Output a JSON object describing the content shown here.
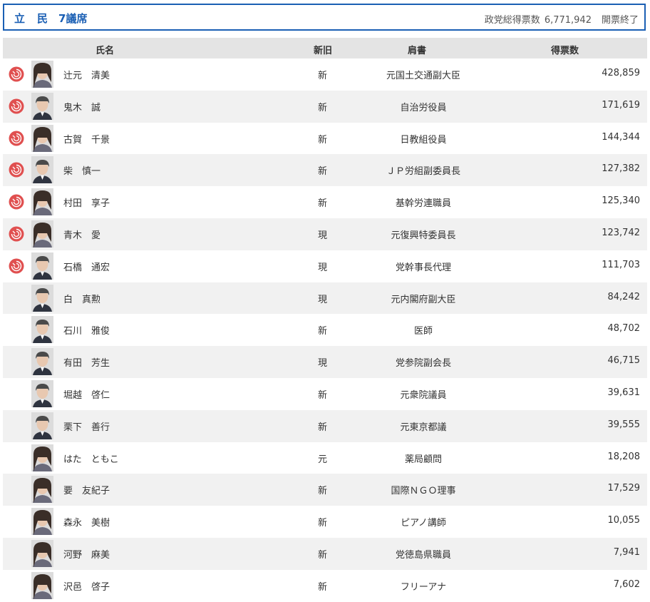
{
  "header": {
    "party": "立　民",
    "seats": "7議席",
    "votes_label": "政党総得票数",
    "total_votes": "6,771,942",
    "status": "開票終了"
  },
  "columns": {
    "name": "氏名",
    "status": "新旧",
    "title": "肩書",
    "votes": "得票数"
  },
  "candidates": [
    {
      "name": "辻元　清美",
      "status": "新",
      "title": "元国土交通副大臣",
      "votes": "428,859",
      "elected": true,
      "gender": "f"
    },
    {
      "name": "鬼木　誠",
      "status": "新",
      "title": "自治労役員",
      "votes": "171,619",
      "elected": true,
      "gender": "m"
    },
    {
      "name": "古賀　千景",
      "status": "新",
      "title": "日教組役員",
      "votes": "144,344",
      "elected": true,
      "gender": "f"
    },
    {
      "name": "柴　慎一",
      "status": "新",
      "title": "ＪＰ労組副委員長",
      "votes": "127,382",
      "elected": true,
      "gender": "m"
    },
    {
      "name": "村田　享子",
      "status": "新",
      "title": "基幹労連職員",
      "votes": "125,340",
      "elected": true,
      "gender": "f"
    },
    {
      "name": "青木　愛",
      "status": "現",
      "title": "元復興特委員長",
      "votes": "123,742",
      "elected": true,
      "gender": "f"
    },
    {
      "name": "石橋　通宏",
      "status": "現",
      "title": "党幹事長代理",
      "votes": "111,703",
      "elected": true,
      "gender": "m"
    },
    {
      "name": "白　真勲",
      "status": "現",
      "title": "元内閣府副大臣",
      "votes": "84,242",
      "elected": false,
      "gender": "m"
    },
    {
      "name": "石川　雅俊",
      "status": "新",
      "title": "医師",
      "votes": "48,702",
      "elected": false,
      "gender": "m"
    },
    {
      "name": "有田　芳生",
      "status": "現",
      "title": "党参院副会長",
      "votes": "46,715",
      "elected": false,
      "gender": "m"
    },
    {
      "name": "堀越　啓仁",
      "status": "新",
      "title": "元衆院議員",
      "votes": "39,631",
      "elected": false,
      "gender": "m"
    },
    {
      "name": "栗下　善行",
      "status": "新",
      "title": "元東京都議",
      "votes": "39,555",
      "elected": false,
      "gender": "m"
    },
    {
      "name": "はた　ともこ",
      "status": "元",
      "title": "薬局顧問",
      "votes": "18,208",
      "elected": false,
      "gender": "f"
    },
    {
      "name": "要　友紀子",
      "status": "新",
      "title": "国際ＮＧＯ理事",
      "votes": "17,529",
      "elected": false,
      "gender": "f"
    },
    {
      "name": "森永　美樹",
      "status": "新",
      "title": "ピアノ講師",
      "votes": "10,055",
      "elected": false,
      "gender": "f"
    },
    {
      "name": "河野　麻美",
      "status": "新",
      "title": "党徳島県職員",
      "votes": "7,941",
      "elected": false,
      "gender": "f"
    },
    {
      "name": "沢邑　啓子",
      "status": "新",
      "title": "フリーアナ",
      "votes": "7,602",
      "elected": false,
      "gender": "f"
    }
  ],
  "colors": {
    "accent": "#1a5fb4",
    "elected_mark": "#e05050",
    "header_bg": "#e4e4e4",
    "row_alt": "#f1f1f1"
  }
}
